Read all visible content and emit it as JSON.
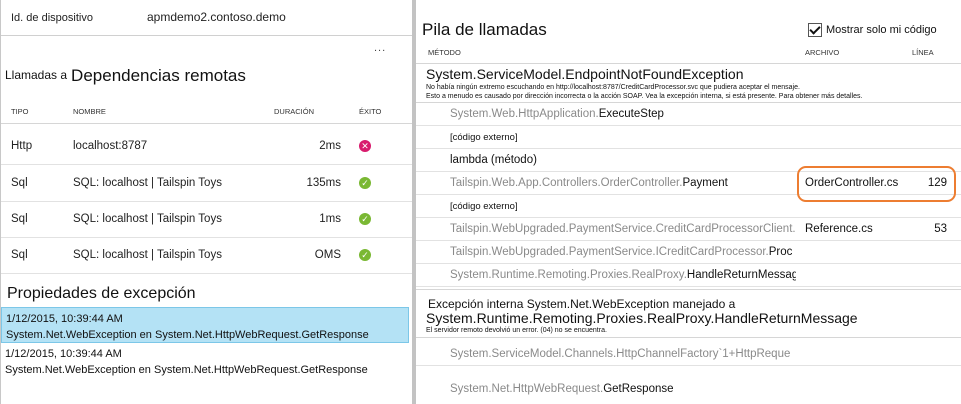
{
  "device": {
    "label": "Id. de dispositivo",
    "value": "apmdemo2.contoso.demo"
  },
  "left_panel": {
    "more_menu": "...",
    "calls_prefix": "Llamadas a",
    "calls_title": "Dependencias remotas",
    "columns": {
      "type": "TIPO",
      "name": "NOMBRE",
      "duration": "DURACIÓN",
      "success": "ÉXITO"
    },
    "dependencies": [
      {
        "type": "Http",
        "name": "localhost:8787",
        "duration": "2ms",
        "status": "failed"
      },
      {
        "type": "Sql",
        "name": "SQL: localhost | Tailspin Toys",
        "duration": "135ms",
        "status": "success"
      },
      {
        "type": "Sql",
        "name": "SQL: localhost | Tailspin Toys",
        "duration": "1ms",
        "status": "success"
      },
      {
        "type": "Sql",
        "name": "SQL: localhost | Tailspin Toys",
        "duration": "OMS",
        "status": "success"
      }
    ],
    "properties_title": "Propiedades de excepción",
    "properties": [
      {
        "date": "1/12/2015, 10:39:44 AM",
        "message": "System.Net.WebException en System.Net.HttpWebRequest.GetResponse",
        "selected": true
      },
      {
        "date": "1/12/2015, 10:39:44 AM",
        "message": "System.Net.WebException en System.Net.HttpWebRequest.GetResponse",
        "selected": false
      }
    ]
  },
  "stack": {
    "title": "Pila de llamadas",
    "only_my_code_label": "Mostrar solo mi código",
    "only_my_code_checked": true,
    "columns": {
      "method": "MÉTODO",
      "file": "ARCHIVO",
      "line": "LÍNEA"
    },
    "outer_exception": {
      "name": "System.ServiceModel.EndpointNotFoundException",
      "message_line1": "No había ningún extremo escuchando en http://localhost:8787/CreditCardProcessor.svc que pudiera aceptar el mensaje.",
      "message_line2": "Esto a menudo es causado por dirección incorrecta o la acción SOAP. Vea la excepción interna, si está presente. Para obtener más detalles."
    },
    "frames": [
      {
        "ns": "System.Web.HttpApplication.",
        "method": "ExecuteStep",
        "file": "",
        "line": "",
        "style": "gray"
      },
      {
        "ns": "",
        "method": "[código externo]",
        "file": "",
        "line": "",
        "style": "small"
      },
      {
        "ns": "",
        "method": "lambda (método)",
        "file": "",
        "line": "",
        "style": "dark"
      },
      {
        "ns": "Tailspin.Web.App.Controllers.OrderController.",
        "method": "Payment",
        "file": "OrderController.cs",
        "line": "129",
        "style": "gray"
      },
      {
        "ns": "",
        "method": "[código externo]",
        "file": "",
        "line": "",
        "style": "small"
      },
      {
        "ns": "Tailspin.WebUpgraded.PaymentService.CreditCardProcessorClient.",
        "method": "",
        "file": "Reference.cs",
        "line": "53",
        "style": "gray"
      },
      {
        "ns": "Tailspin.WebUpgraded.PaymentService.ICreditCardProcessor.",
        "method": "Proc",
        "file": "",
        "line": "",
        "style": "gray"
      },
      {
        "ns": "System.Runtime.Remoting.Proxies.RealProxy.",
        "method": "HandleReturnMessage",
        "file": "",
        "line": "",
        "style": "gray"
      }
    ],
    "inner_exception": {
      "lead": "Excepción interna System.Net.WebException manejado a",
      "name": "System.Runtime.Remoting.Proxies.RealProxy.HandleReturnMessage",
      "message": "El servidor remoto devolvió un error. (04) no se encuentra."
    },
    "inner_frames": [
      {
        "ns": "System.ServiceModel.Channels.HttpChannelFactory`1+HttpReque",
        "method": "",
        "style": "gray"
      },
      {
        "ns": "System.Net.HttpWebRequest.",
        "method": "GetResponse",
        "style": "gray"
      }
    ]
  }
}
